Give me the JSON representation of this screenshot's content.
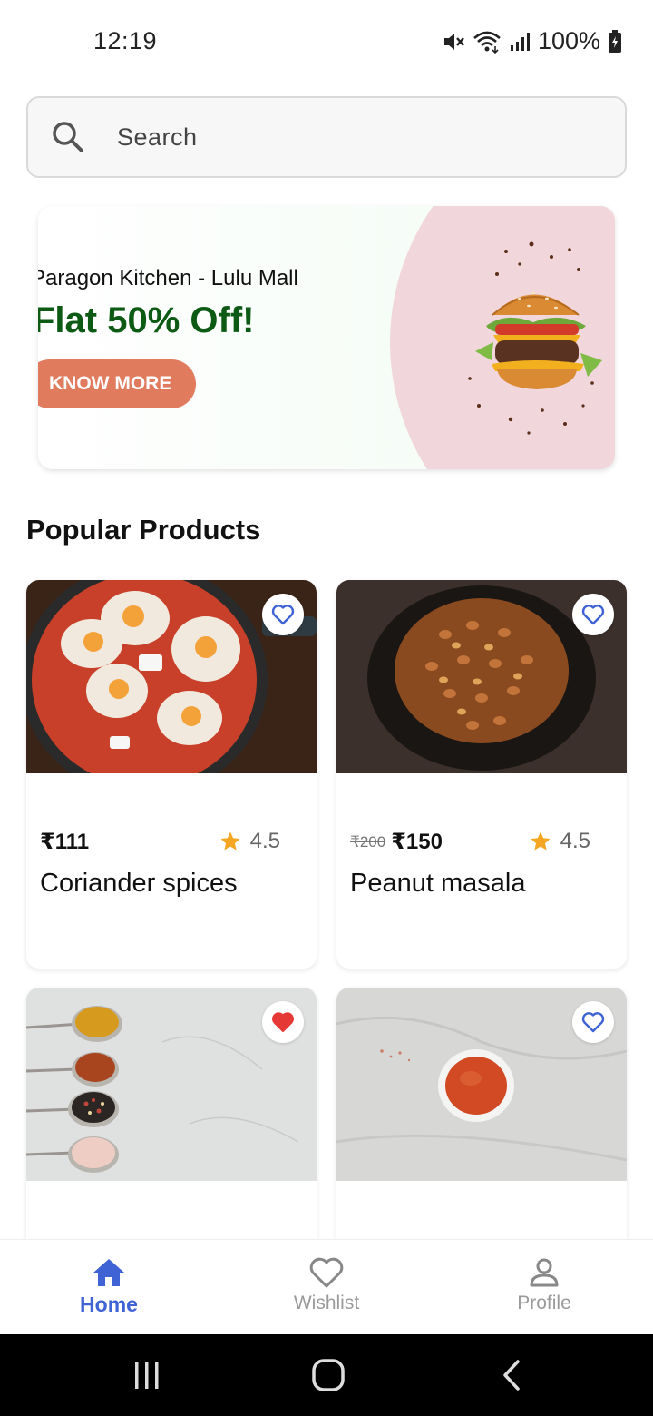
{
  "status_bar": {
    "time": "12:19",
    "battery": "100%"
  },
  "search": {
    "placeholder": "Search"
  },
  "banner": {
    "subtitle": "Paragon Kitchen - Lulu Mall",
    "title": "Flat 50% Off!",
    "button_label": "KNOW MORE",
    "colors": {
      "title": "#0d5a15",
      "button": "#e07b5e",
      "circle": "#f1d7dc"
    }
  },
  "popular": {
    "title": "Popular Products",
    "products": [
      {
        "image": "shakshuka-pan",
        "price": "₹111",
        "old_price": "",
        "rating": "4.5",
        "name": "Coriander spices",
        "favorited": false
      },
      {
        "image": "peanut-masala-plate",
        "price": "₹150",
        "old_price": "₹200",
        "rating": "4.5",
        "name": "Peanut masala",
        "favorited": false
      },
      {
        "image": "spice-spoons",
        "price": "",
        "old_price": "",
        "rating": "",
        "name": "",
        "favorited": true
      },
      {
        "image": "chili-powder-bowl",
        "price": "",
        "old_price": "",
        "rating": "",
        "name": "",
        "favorited": false
      }
    ]
  },
  "bottom_nav": {
    "items": [
      {
        "label": "Home",
        "icon": "home-icon",
        "active": true
      },
      {
        "label": "Wishlist",
        "icon": "heart-icon",
        "active": false
      },
      {
        "label": "Profile",
        "icon": "person-icon",
        "active": false
      }
    ]
  },
  "colors": {
    "accent": "#3f63d4",
    "heart_active": "#e53935",
    "star": "#f5a623"
  }
}
